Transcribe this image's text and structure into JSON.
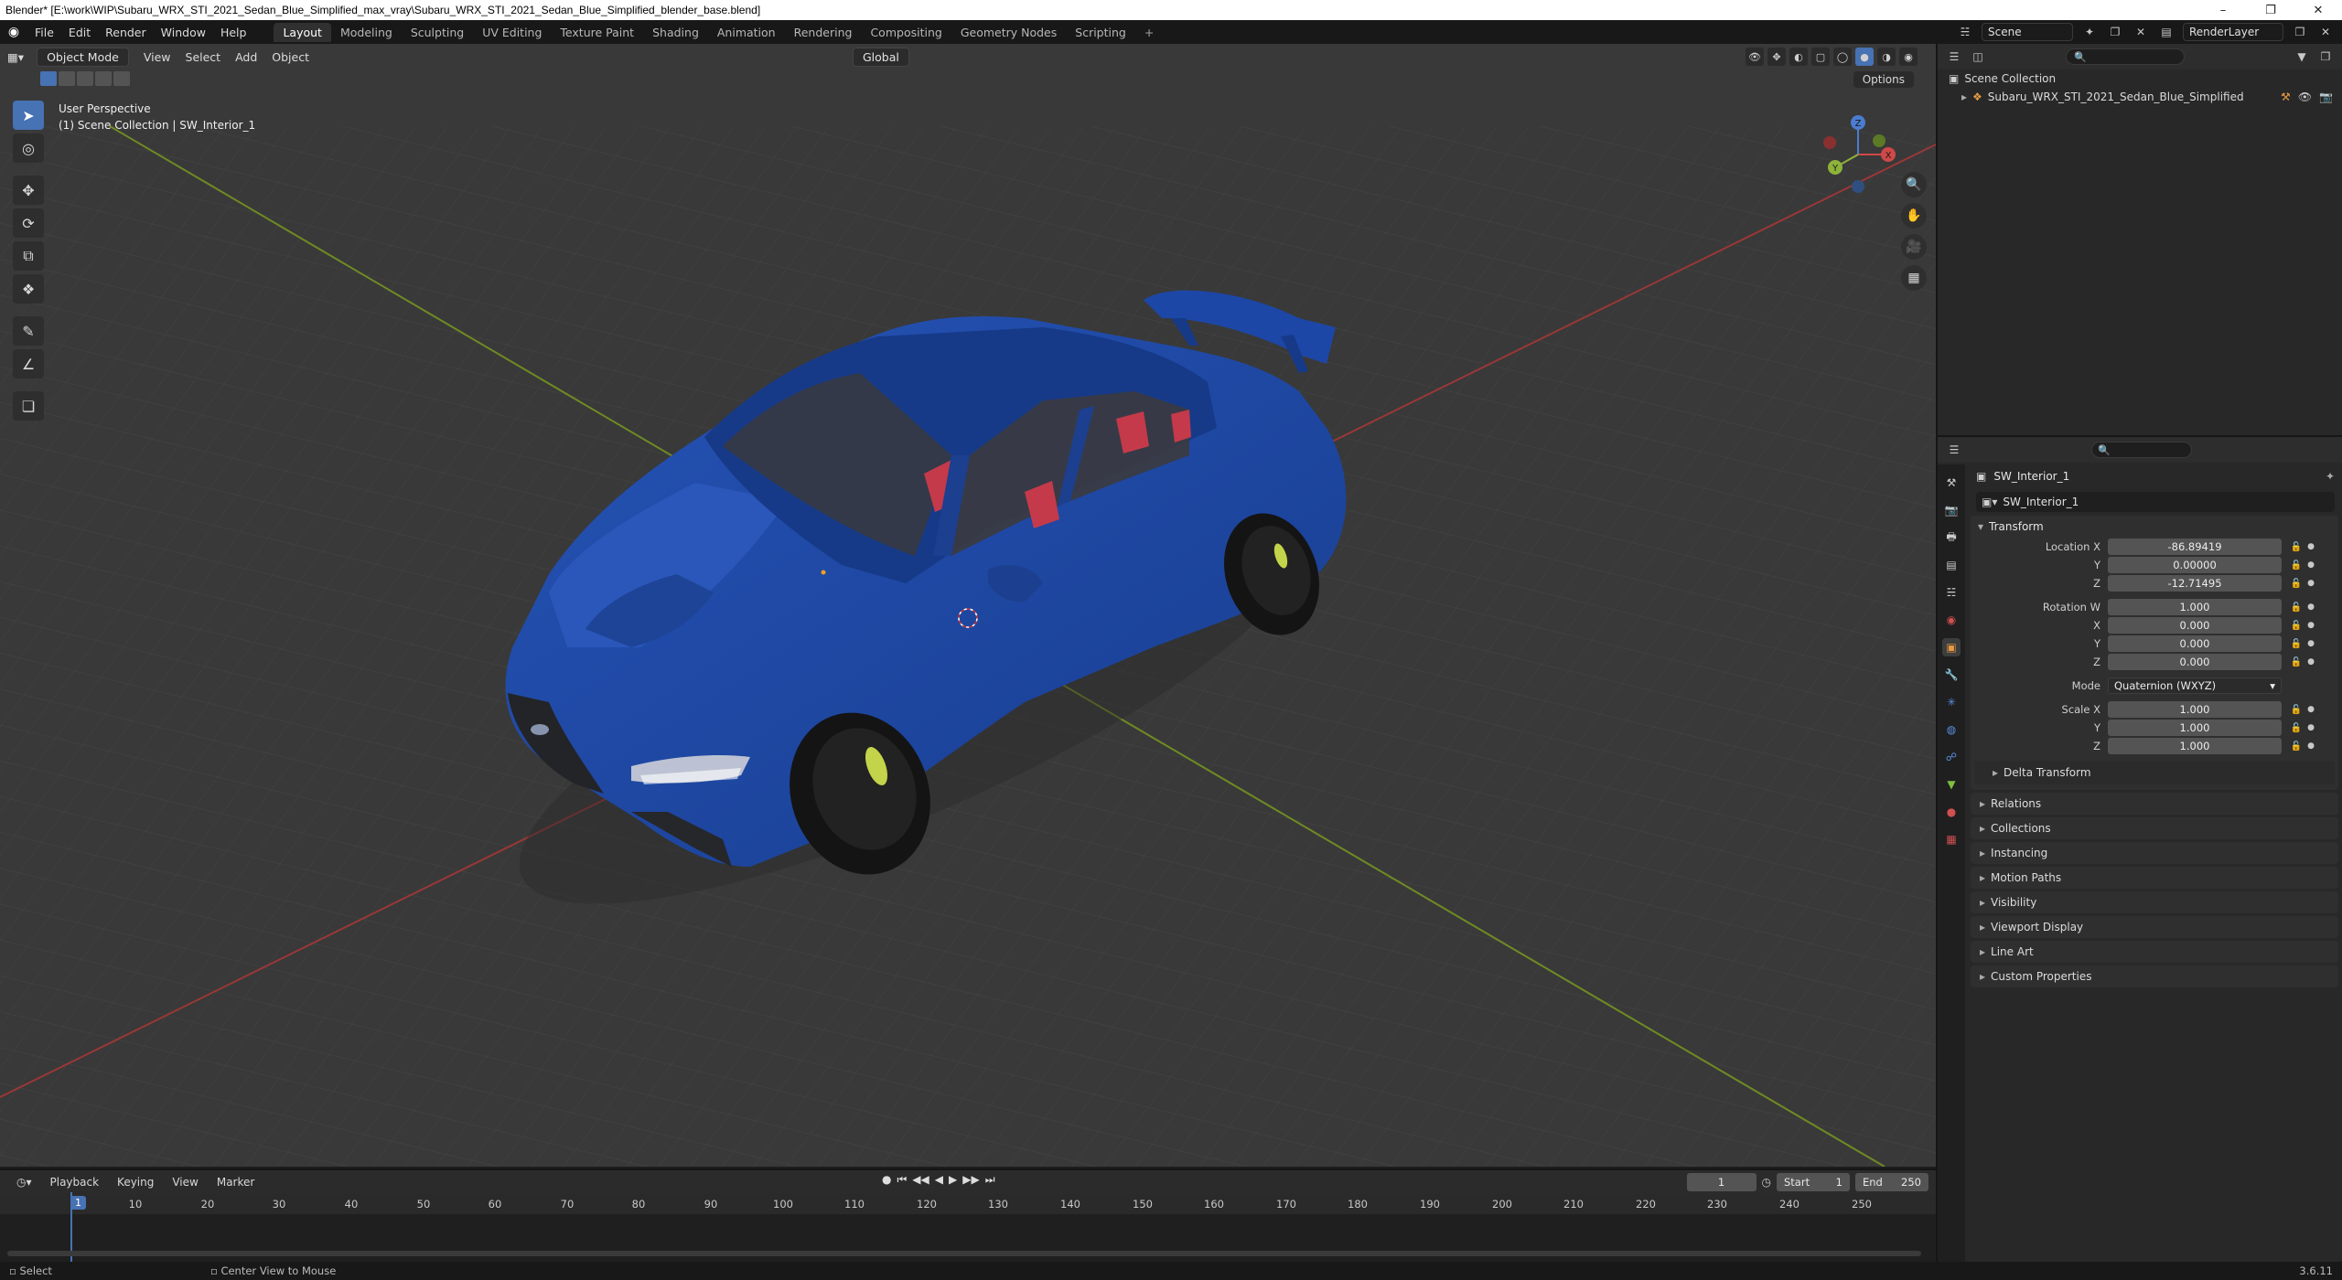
{
  "window": {
    "title": "Blender* [E:\\work\\WIP\\Subaru_WRX_STI_2021_Sedan_Blue_Simplified_max_vray\\Subaru_WRX_STI_2021_Sedan_Blue_Simplified_blender_base.blend]",
    "minimize": "–",
    "maximize": "❐",
    "close": "✕"
  },
  "menubar": {
    "items": [
      "File",
      "Edit",
      "Render",
      "Window",
      "Help"
    ],
    "workspaces": [
      "Layout",
      "Modeling",
      "Sculpting",
      "UV Editing",
      "Texture Paint",
      "Shading",
      "Animation",
      "Rendering",
      "Compositing",
      "Geometry Nodes",
      "Scripting"
    ],
    "add_tab": "+",
    "scene": "Scene",
    "render_layer": "RenderLayer"
  },
  "viewport": {
    "mode": "Object Mode",
    "menus": [
      "View",
      "Select",
      "Add",
      "Object"
    ],
    "orientation": "Global",
    "options": "Options",
    "info_line1": "User Perspective",
    "info_line2": "(1) Scene Collection | SW_Interior_1",
    "gizmo_labels": {
      "x": "X",
      "y": "Y",
      "z": "Z"
    }
  },
  "outliner": {
    "root": "Scene Collection",
    "items": [
      {
        "label": "Subaru_WRX_STI_2021_Sedan_Blue_Simplified"
      }
    ],
    "search_placeholder": ""
  },
  "properties": {
    "object_name": "SW_Interior_1",
    "datablock_name": "SW_Interior_1",
    "transform_title": "Transform",
    "location": {
      "label_x": "Location X",
      "label_y": "Y",
      "label_z": "Z",
      "x": "-86.89419",
      "y": "0.00000",
      "z": "-12.71495"
    },
    "rotation": {
      "label_w": "Rotation W",
      "label_x": "X",
      "label_y": "Y",
      "label_z": "Z",
      "w": "1.000",
      "x": "0.000",
      "y": "0.000",
      "z": "0.000"
    },
    "mode_label": "Mode",
    "mode_value": "Quaternion (WXYZ)",
    "scale": {
      "label_x": "Scale X",
      "label_y": "Y",
      "label_z": "Z",
      "x": "1.000",
      "y": "1.000",
      "z": "1.000"
    },
    "delta_transform": "Delta Transform",
    "panels": [
      "Relations",
      "Collections",
      "Instancing",
      "Motion Paths",
      "Visibility",
      "Viewport Display",
      "Line Art",
      "Custom Properties"
    ]
  },
  "timeline": {
    "menus": [
      "Playback",
      "Keying",
      "View",
      "Marker"
    ],
    "current_frame": "1",
    "start_label": "Start",
    "start": "1",
    "end_label": "End",
    "end": "250",
    "ticks": [
      "10",
      "20",
      "30",
      "40",
      "50",
      "60",
      "70",
      "80",
      "90",
      "100",
      "110",
      "120",
      "130",
      "140",
      "150",
      "160",
      "170",
      "180",
      "190",
      "200",
      "210",
      "220",
      "230",
      "240",
      "250"
    ]
  },
  "statusbar": {
    "left": "Select",
    "middle": "Center View to Mouse",
    "version": "3.6.11"
  },
  "colors": {
    "accent": "#4772b3",
    "car_body": "#1f47a0",
    "axis_x": "#b13a3a",
    "axis_y": "#7e9a2a"
  }
}
